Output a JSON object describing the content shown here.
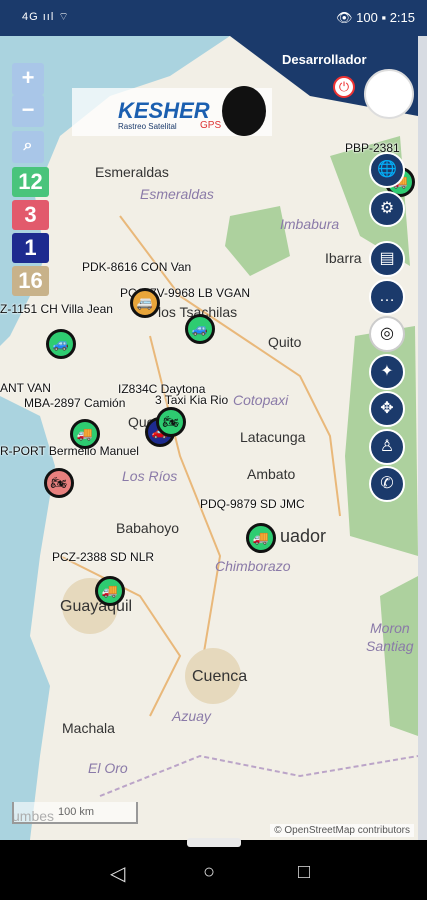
{
  "statusbar": {
    "left": "4G ııl  ⌔",
    "time": "2:15",
    "battery": "100"
  },
  "header": {
    "user": "Desarrollador"
  },
  "logo": {
    "brand": "KESHER",
    "sub": "Rastreo Satelital",
    "tag": "GPS"
  },
  "map_controls": {
    "zoom_in": "+",
    "zoom_out": "−",
    "search": "⌕"
  },
  "counters": [
    {
      "value": "12",
      "color": "#49c47b"
    },
    {
      "value": "3",
      "color": "#e25a6c"
    },
    {
      "value": "1",
      "color": "#1d2b8f"
    },
    {
      "value": "16",
      "color": "#c8b28a"
    }
  ],
  "places": {
    "esmeraldas_city": "Esmeraldas",
    "esmeraldas_region": "Esmeraldas",
    "imbabura": "Imbabura",
    "ibarra": "Ibarra",
    "los_bachilas": "los Tsachilas",
    "quito": "Quito",
    "cotopaxi": "Cotopaxi",
    "latacunga": "Latacunga",
    "quevedo": "Quevedo",
    "los_rios": "Los Ríos",
    "ambato": "Ambato",
    "babahoyo": "Babahoyo",
    "ecuador": "uador",
    "chimborazo": "Chimborazo",
    "guayaquil": "Guayaquil",
    "morona": "Moron",
    "santiago": "Santiag",
    "cuenca": "Cuenca",
    "azuay": "Azuay",
    "machala": "Machala",
    "el_oro": "El Oro",
    "tumbes": "umbes"
  },
  "vehicles": [
    {
      "label": "PBP-2381"
    },
    {
      "label": "PDK-8616 CON Van"
    },
    {
      "label": "PCG-7V-9968 LB VGAN"
    },
    {
      "label": "Z-1151 CH Villa Jean"
    },
    {
      "label": "ANT VAN"
    },
    {
      "label": "MBA-2897 Camión"
    },
    {
      "label": "IZ834C Daytona"
    },
    {
      "label": "3 Taxi Kia Rio"
    },
    {
      "label": "R-PORT Bermello Manuel"
    },
    {
      "label": "PDQ-9879 SD JMC"
    },
    {
      "label": "PCZ-2388 SD NLR"
    }
  ],
  "scale": "100 km",
  "attribution": "© OpenStreetMap contributors"
}
